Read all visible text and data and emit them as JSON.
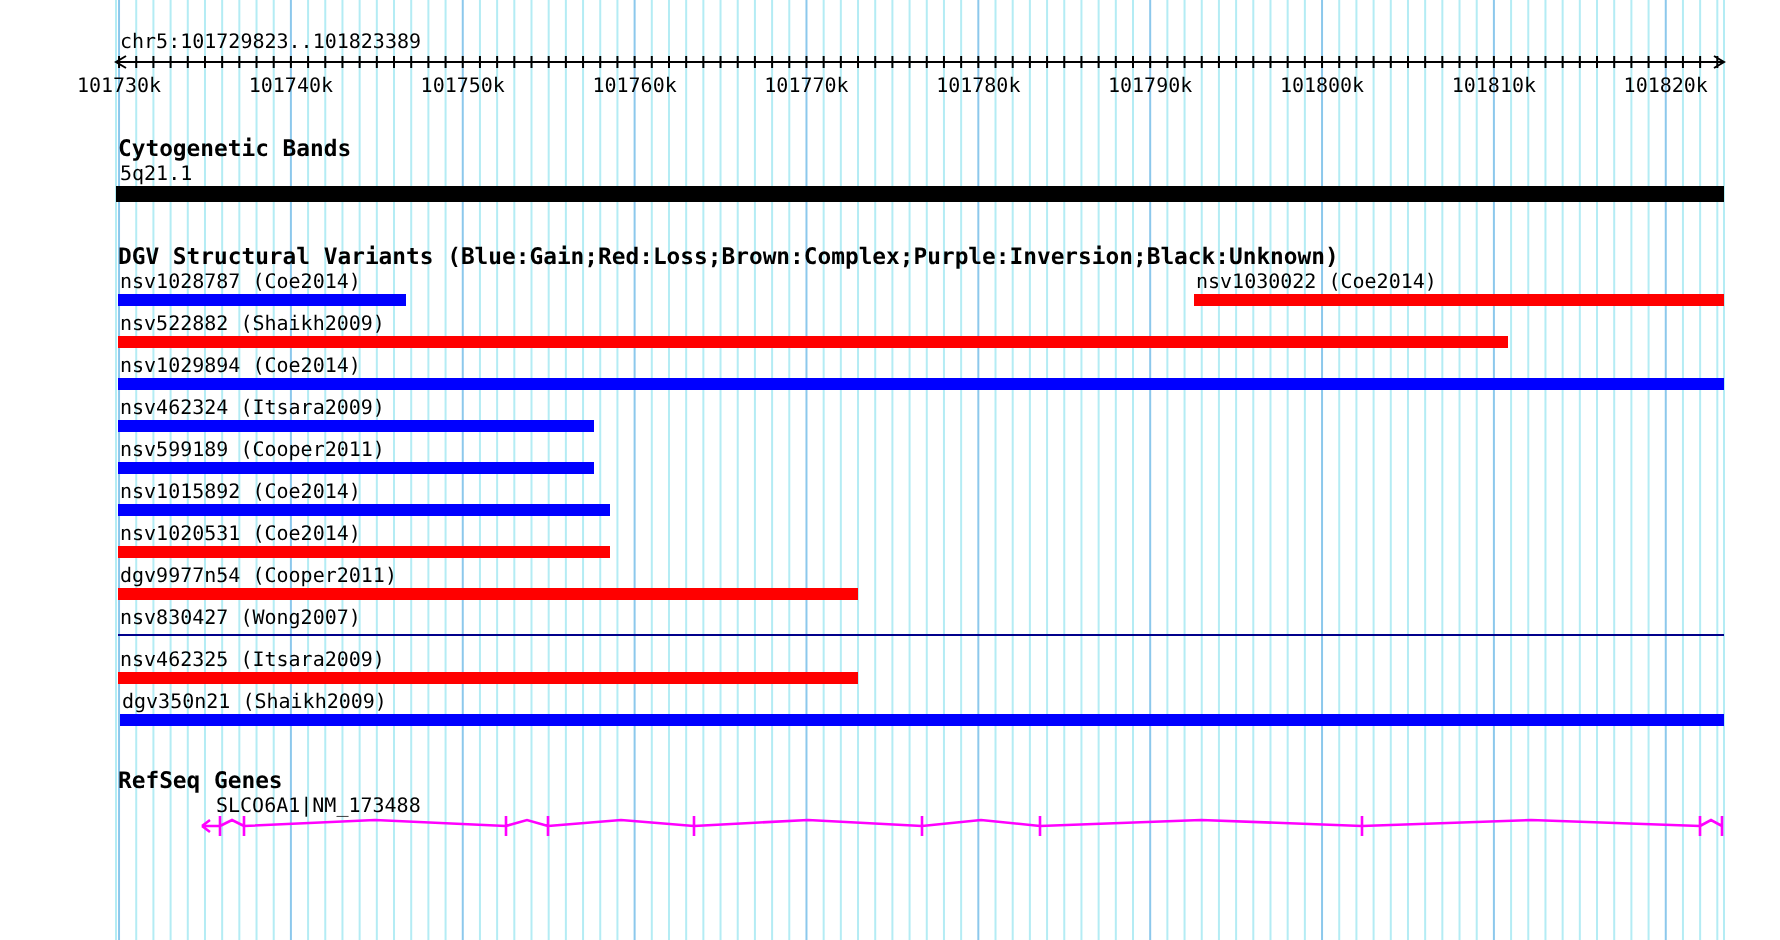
{
  "position": "chr5:101729823..101823389",
  "ruler": {
    "tick_labels": [
      "101730k",
      "101740k",
      "101750k",
      "101760k",
      "101770k",
      "101780k",
      "101790k",
      "101800k",
      "101810k",
      "101820k"
    ]
  },
  "cytogenetic_bands": {
    "title": "Cytogenetic Bands",
    "bands": [
      {
        "label": "5q21.1",
        "color": "#000000"
      }
    ]
  },
  "dgv": {
    "title": "DGV Structural Variants (Blue:Gain;Red:Loss;Brown:Complex;Purple:Inversion;Black:Unknown)",
    "rows": [
      {
        "features": [
          {
            "label": "nsv1028787 (Coe2014)",
            "kind": "bar",
            "color": "#0000ff"
          },
          {
            "label": "nsv1030022 (Coe2014)",
            "kind": "bar",
            "color": "#ff0000"
          }
        ]
      },
      {
        "features": [
          {
            "label": "nsv522882 (Shaikh2009)",
            "kind": "bar",
            "color": "#ff0000"
          }
        ]
      },
      {
        "features": [
          {
            "label": "nsv1029894 (Coe2014)",
            "kind": "bar",
            "color": "#0000ff"
          }
        ]
      },
      {
        "features": [
          {
            "label": "nsv462324 (Itsara2009)",
            "kind": "bar",
            "color": "#0000ff"
          }
        ]
      },
      {
        "features": [
          {
            "label": "nsv599189 (Cooper2011)",
            "kind": "bar",
            "color": "#0000ff"
          }
        ]
      },
      {
        "features": [
          {
            "label": "nsv1015892 (Coe2014)",
            "kind": "bar",
            "color": "#0000ff"
          }
        ]
      },
      {
        "features": [
          {
            "label": "nsv1020531 (Coe2014)",
            "kind": "bar",
            "color": "#ff0000"
          }
        ]
      },
      {
        "features": [
          {
            "label": "dgv9977n54 (Cooper2011)",
            "kind": "bar",
            "color": "#ff0000"
          }
        ]
      },
      {
        "features": [
          {
            "label": "nsv830427 (Wong2007)",
            "kind": "line",
            "color": "#00008b"
          }
        ]
      },
      {
        "features": [
          {
            "label": "nsv462325 (Itsara2009)",
            "kind": "bar",
            "color": "#ff0000"
          }
        ]
      },
      {
        "features": [
          {
            "label": "dgv350n21 (Shaikh2009)",
            "kind": "bar",
            "color": "#0000ff"
          }
        ]
      }
    ]
  },
  "refseq_genes": {
    "title": "RefSeq Genes",
    "genes": [
      {
        "label": "SLCO6A1|NM_173488",
        "color": "#ff00ff"
      }
    ]
  }
}
